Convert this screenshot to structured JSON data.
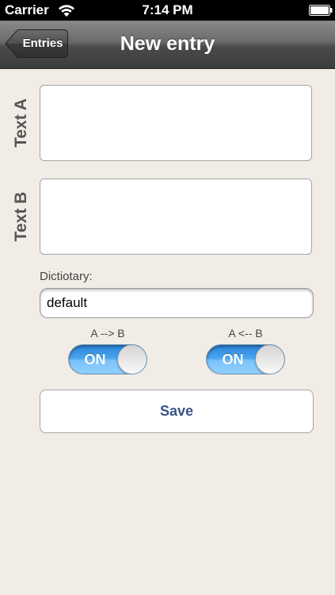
{
  "status_bar": {
    "carrier": "Carrier",
    "time": "7:14 PM",
    "wifi_icon": "wifi-icon",
    "battery_icon": "battery-icon"
  },
  "nav": {
    "back_label": "Entries",
    "title": "New entry"
  },
  "form": {
    "text_a_label": "Text A",
    "text_a_value": "",
    "text_b_label": "Text B",
    "text_b_value": "",
    "dictionary_label": "Dictiotary:",
    "dictionary_value": "default",
    "switch_ab_label": "A --> B",
    "switch_ab_state": "ON",
    "switch_ba_label": "A <-- B",
    "switch_ba_state": "ON",
    "save_label": "Save"
  },
  "colors": {
    "background": "#f1ede6",
    "toggle_on": "#49a4ef",
    "save_text": "#385487"
  }
}
